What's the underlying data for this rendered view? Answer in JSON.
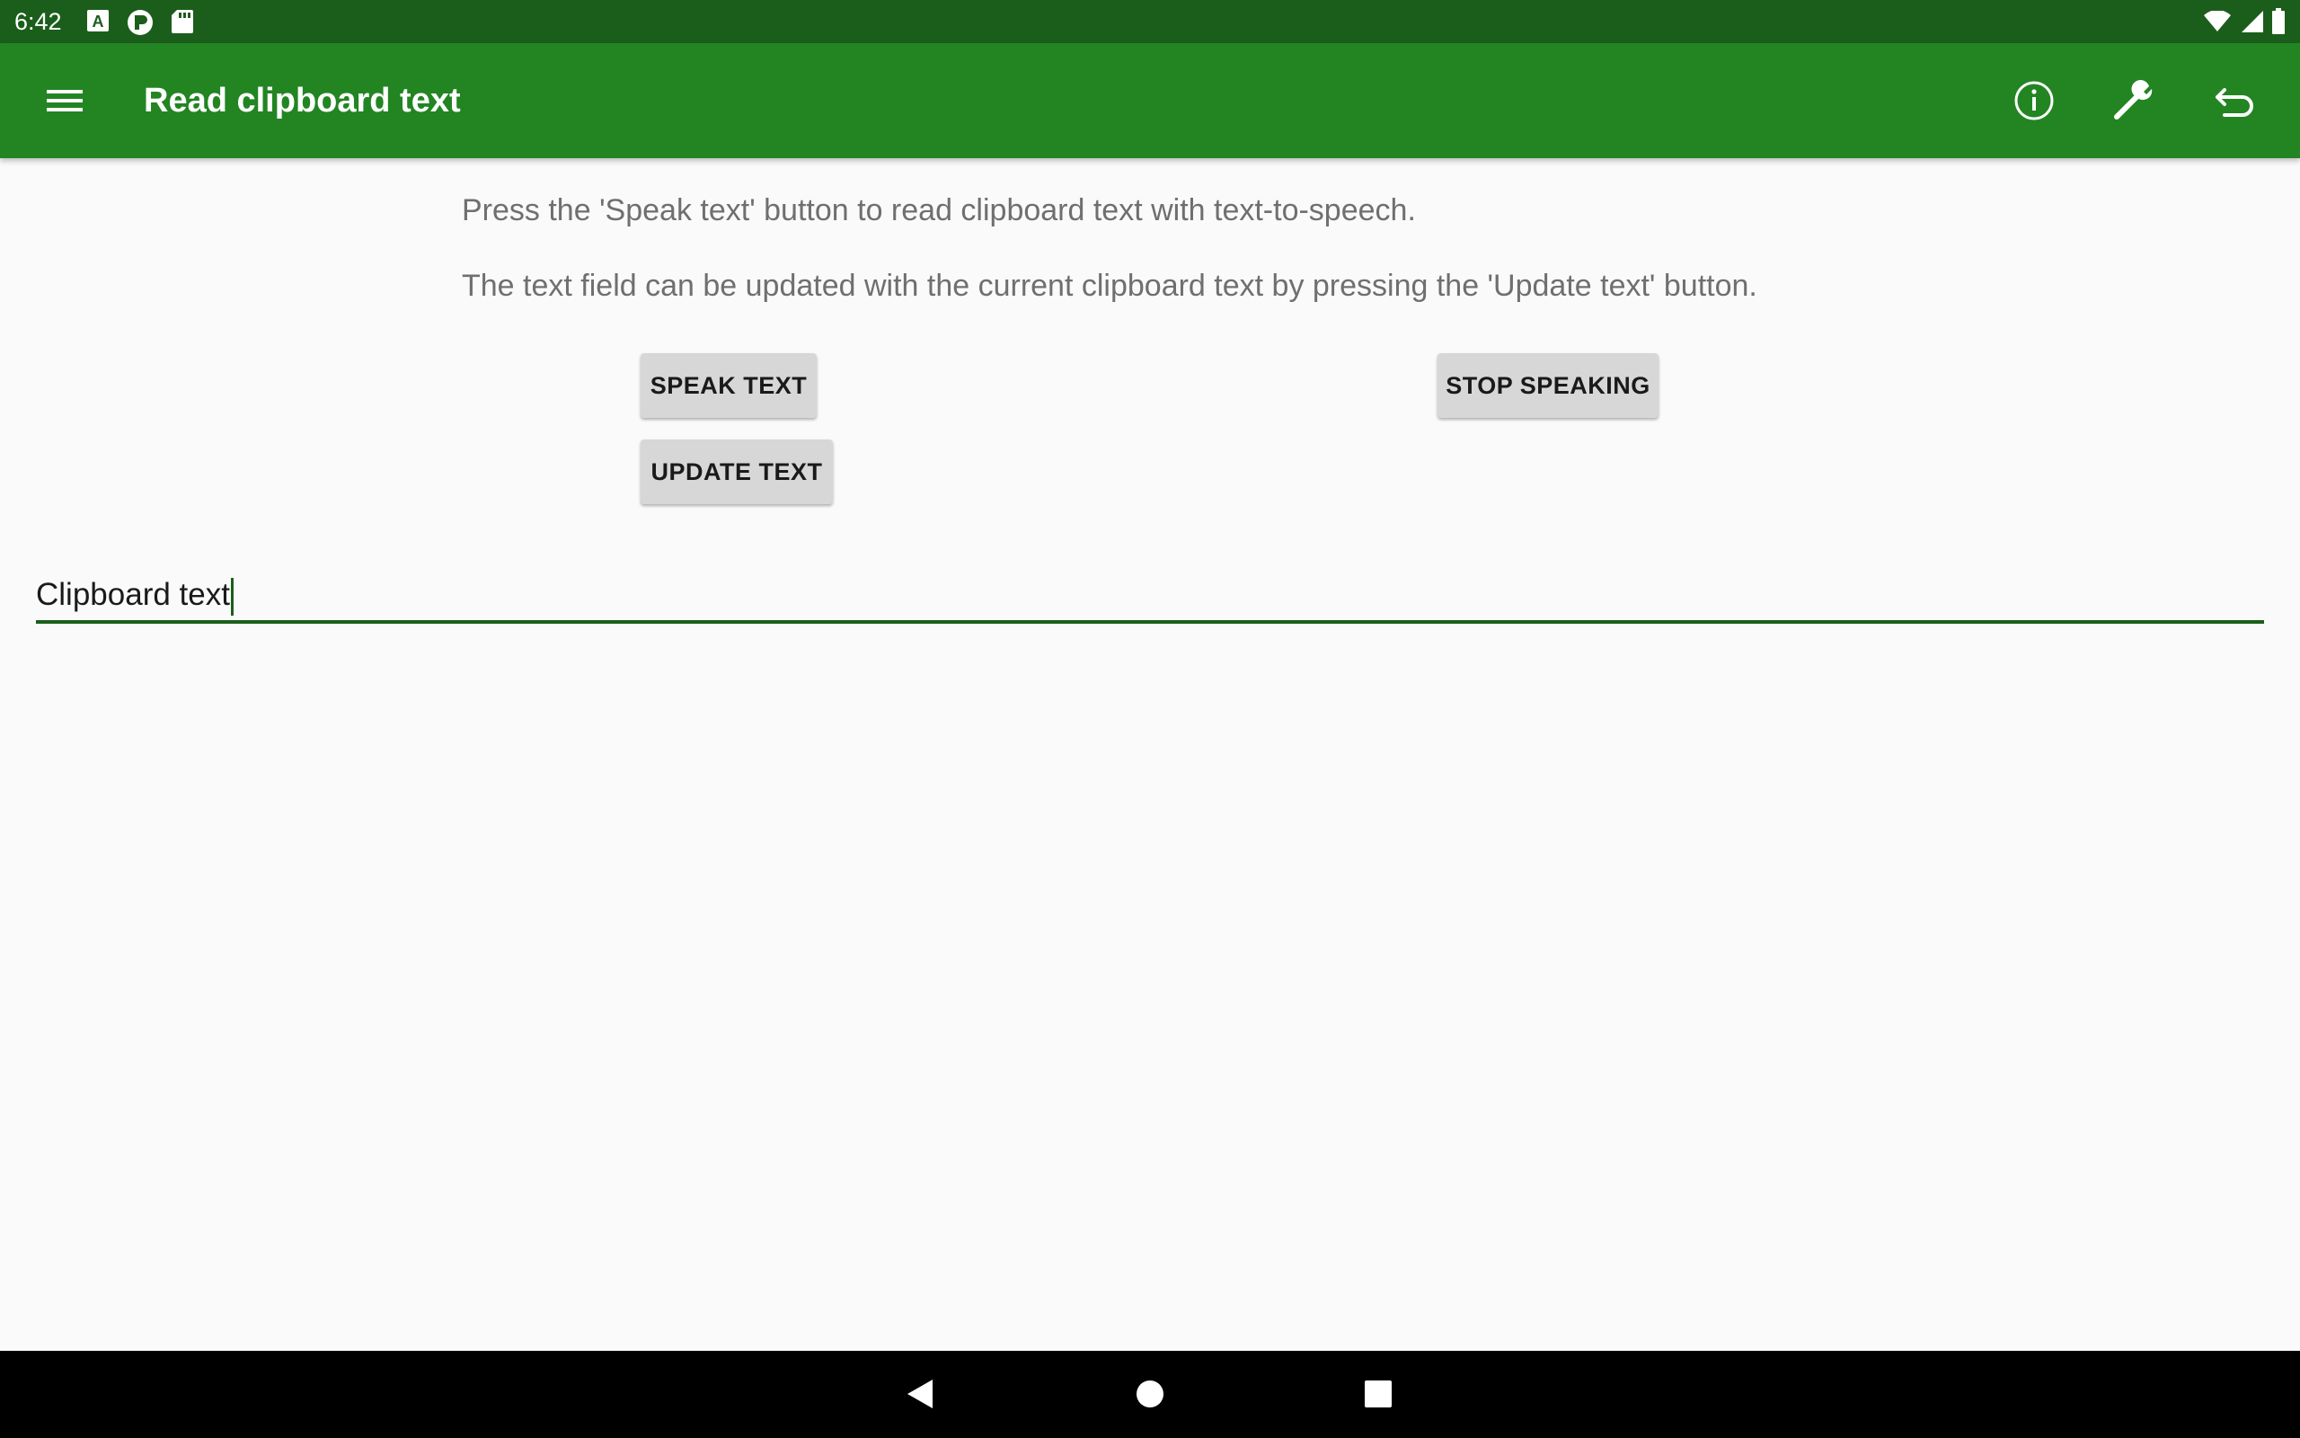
{
  "status_bar": {
    "time": "6:42",
    "left_icons": [
      "notification-a-icon",
      "notification-p-icon",
      "sd-card-icon"
    ],
    "right_icons": [
      "wifi-icon",
      "cell-signal-icon",
      "battery-icon"
    ]
  },
  "app_bar": {
    "title": "Read clipboard text",
    "menu_icon": "hamburger-menu-icon",
    "actions": [
      "info-icon",
      "wrench-icon",
      "undo-icon"
    ],
    "background": "#228522",
    "status_background": "#1b5e1b"
  },
  "instructions": {
    "line1": "Press the 'Speak text' button to read clipboard text with text-to-speech.",
    "line2": "The text field can be updated with the current clipboard text by pressing the 'Update text' button."
  },
  "buttons": {
    "speak": "SPEAK TEXT",
    "stop": "STOP SPEAKING",
    "update": "UPDATE TEXT"
  },
  "text_field": {
    "value": "Clipboard text"
  },
  "nav_bar": {
    "icons": [
      "back-icon",
      "home-icon",
      "recents-icon"
    ]
  }
}
